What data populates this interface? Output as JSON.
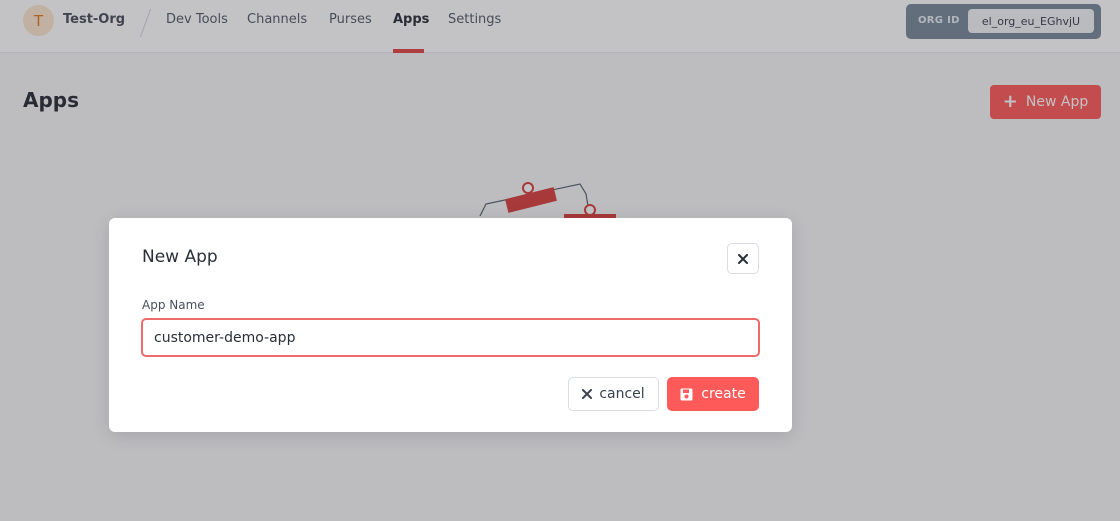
{
  "org": {
    "avatar_letter": "T",
    "name": "Test-Org",
    "id_label": "ORG ID",
    "id_value": "el_org_eu_EGhvjU"
  },
  "nav": {
    "items": [
      {
        "label": "Dev Tools",
        "active": false
      },
      {
        "label": "Channels",
        "active": false
      },
      {
        "label": "Purses",
        "active": false
      },
      {
        "label": "Apps",
        "active": true
      },
      {
        "label": "Settings",
        "active": false
      }
    ]
  },
  "page": {
    "title": "Apps",
    "new_app_label": "New App"
  },
  "modal": {
    "title": "New App",
    "field_label": "App Name",
    "field_value": "customer-demo-app",
    "cancel_label": "cancel",
    "create_label": "create"
  },
  "colors": {
    "accent": "#ff5a5a",
    "org_box": "#7b8a9c"
  },
  "icons": {
    "close": "close-icon",
    "cancel": "x-icon",
    "create": "save-icon",
    "new_app": "plus-icon"
  }
}
